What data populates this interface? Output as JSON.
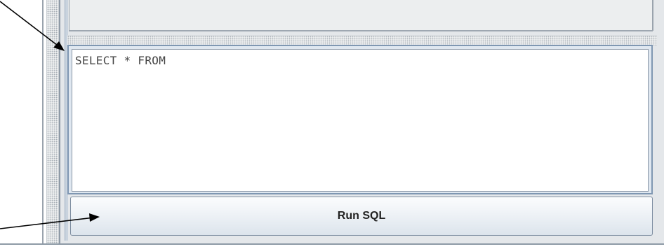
{
  "editor": {
    "sql_text": "SELECT * FROM"
  },
  "run_button": {
    "label": "Run SQL"
  },
  "colors": {
    "panel_border": "#7f97b2",
    "button_border": "#7d8da0",
    "annotation_arrow": "#000000"
  },
  "annotations": [
    {
      "icon": "arrow-icon",
      "points_to": "sql-editor"
    },
    {
      "icon": "arrow-icon",
      "points_to": "run-sql-button"
    }
  ]
}
